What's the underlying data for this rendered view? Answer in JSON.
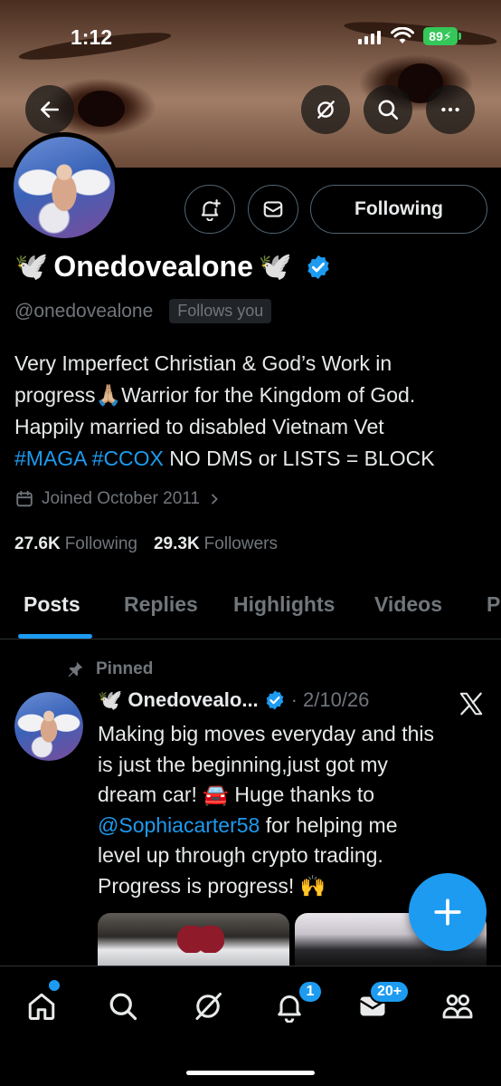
{
  "status_bar": {
    "time": "1:12",
    "battery": "89"
  },
  "header": {
    "back_icon": "arrow-left-icon",
    "grok_icon": "grok-icon",
    "search_icon": "search-icon",
    "more_icon": "more-icon"
  },
  "profile": {
    "display_name": "Onedovealone",
    "name_prefix_emoji": "🕊️",
    "name_suffix_emoji": "🕊️",
    "handle": "@onedovealone",
    "follows_you": "Follows you",
    "bio_line1": "Very Imperfect Christian & God’s Work in",
    "bio_line2_a": "progress",
    "bio_line2_emoji": "🙏🏼",
    "bio_line2_b": "Warrior for the Kingdom of God.",
    "bio_line3": "Happily married to disabled Vietnam Vet",
    "bio_tag1": "#MAGA",
    "bio_tag2": "#CCOX",
    "bio_line4_rest": "NO DMS or LISTS = BLOCK",
    "joined": "Joined October 2011",
    "following_count": "27.6K",
    "following_label": "Following",
    "followers_count": "29.3K",
    "followers_label": "Followers",
    "following_button": "Following"
  },
  "tabs": [
    "Posts",
    "Replies",
    "Highlights",
    "Videos",
    "P"
  ],
  "pinned_post": {
    "pinned_label": "Pinned",
    "author": "Onedovealo...",
    "author_emoji": "🕊️",
    "separator": "·",
    "date": "2/10/26",
    "line1": "Making big moves everyday and this",
    "line2": "is just the beginning,just got my",
    "line3_a": "dream car!",
    "line3_emoji": "🚘",
    "line3_b": "Huge thanks to",
    "mention": "@Sophiacarter58",
    "line4_b": "for helping me",
    "line5": "level up through crypto trading.",
    "line6_a": "Progress is progress!",
    "line6_emoji": "🙌"
  },
  "bottom_nav": {
    "notifications_badge": "1",
    "messages_badge": "20+"
  },
  "colors": {
    "accent": "#1d9bf0",
    "muted": "#71767b",
    "background": "#000000"
  }
}
